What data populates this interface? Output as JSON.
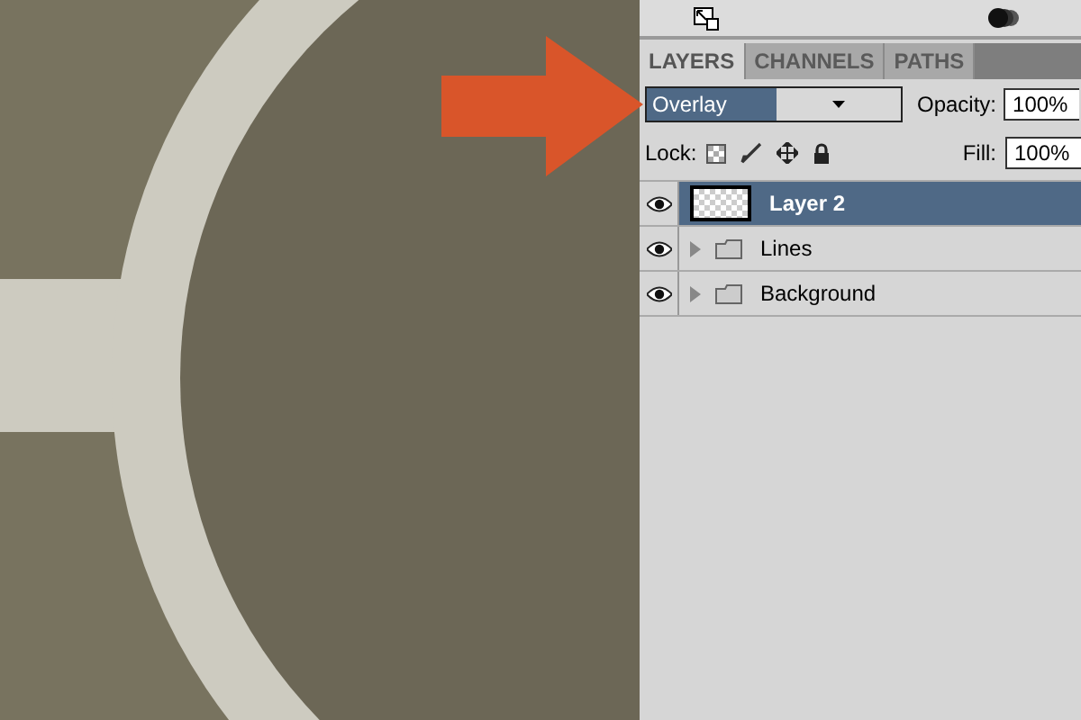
{
  "panel_tabs": [
    {
      "label": "LAYERS",
      "selected": true
    },
    {
      "label": "CHANNELS",
      "selected": false
    },
    {
      "label": "PATHS",
      "selected": false
    }
  ],
  "blend_mode": {
    "value": "Overlay"
  },
  "opacity": {
    "label": "Opacity:",
    "value": "100%"
  },
  "lock": {
    "label": "Lock:"
  },
  "fill": {
    "label": "Fill:",
    "value": "100%"
  },
  "layers": [
    {
      "name": "Layer 2",
      "kind": "layer",
      "visible": true,
      "selected": true
    },
    {
      "name": "Lines",
      "kind": "group",
      "visible": true,
      "selected": false
    },
    {
      "name": "Background",
      "kind": "group",
      "visible": true,
      "selected": false
    }
  ]
}
